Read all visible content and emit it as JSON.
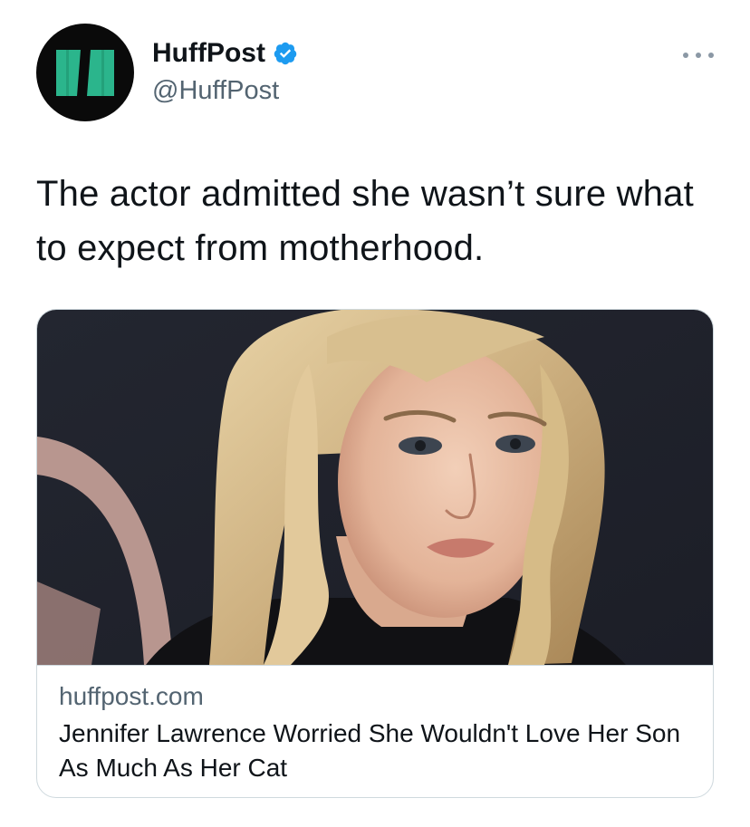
{
  "tweet": {
    "author": {
      "display_name": "HuffPost",
      "handle": "@HuffPost",
      "verified": true,
      "avatar_icon": "huffpost-logo-icon",
      "brand_color": "#2bb58c"
    },
    "more_icon": "more-options-icon",
    "text": "The actor admitted she wasn’t sure what to expect from motherhood.",
    "card": {
      "domain": "huffpost.com",
      "title": "Jennifer Lawrence Worried She Wouldn't Love Her Son As Much As Her Cat",
      "image_icon": "article-photo"
    }
  },
  "colors": {
    "verified_blue": "#1d9bf0",
    "secondary_text": "#536471",
    "border": "#cfd9de"
  }
}
